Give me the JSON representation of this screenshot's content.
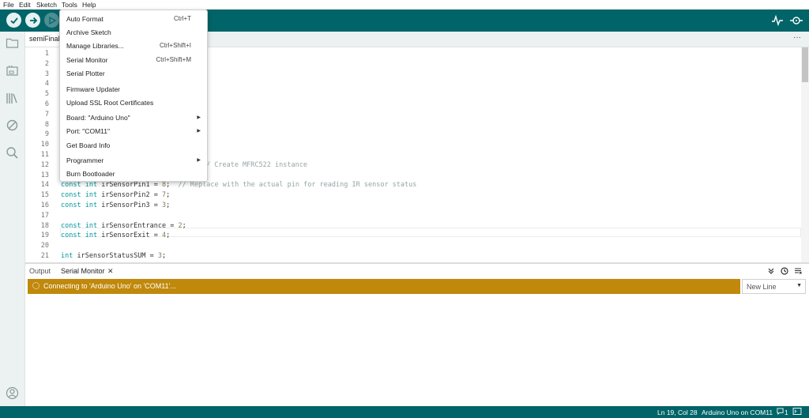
{
  "menubar": {
    "file": "File",
    "edit": "Edit",
    "sketch": "Sketch",
    "tools": "Tools",
    "help": "Help"
  },
  "toolbar": {
    "verify_icon": "check-icon",
    "upload_icon": "arrow-right-icon",
    "debug_icon": "debug-icon",
    "serial_plotter_icon": "plotter-icon",
    "serial_monitor_icon": "serial-monitor-icon",
    "accent_color": "#006468"
  },
  "tabs": {
    "active": "semiFinal",
    "more": "···"
  },
  "editor": {
    "lines": [
      {
        "n": "1",
        "text": ""
      },
      {
        "n": "2",
        "text": ""
      },
      {
        "n": "3",
        "text": ""
      },
      {
        "n": "4",
        "text": ""
      },
      {
        "n": "5",
        "text": ""
      },
      {
        "n": "6",
        "text": ""
      },
      {
        "n": "7",
        "text": ""
      },
      {
        "n": "8",
        "text": ""
      },
      {
        "n": "9",
        "text": ""
      },
      {
        "n": "10",
        "text": ""
      },
      {
        "n": "11",
        "text": ""
      },
      {
        "n": "12",
        "text": "/ Create MFRC522 instance"
      },
      {
        "n": "13",
        "text": ""
      },
      {
        "n": "14",
        "text": "const int irSensorPin1 = 8;  // Replace with the actual pin for reading IR sensor status"
      },
      {
        "n": "15",
        "text": "const int irSensorPin2 = 7;"
      },
      {
        "n": "16",
        "text": "const int irSensorPin3 = 3;"
      },
      {
        "n": "17",
        "text": ""
      },
      {
        "n": "18",
        "text": "const int irSensorEntrance = 2;"
      },
      {
        "n": "19",
        "text": "const int irSensorExit = 4;"
      },
      {
        "n": "20",
        "text": ""
      },
      {
        "n": "21",
        "text": "int irSensorStatusSUM = 3;"
      }
    ]
  },
  "tools_menu": {
    "items": [
      {
        "label": "Auto Format",
        "shortcut": "Ctrl+T"
      },
      {
        "label": "Archive Sketch",
        "shortcut": ""
      },
      {
        "label": "Manage Libraries...",
        "shortcut": "Ctrl+Shift+I"
      },
      {
        "label": "Serial Monitor",
        "shortcut": "Ctrl+Shift+M"
      },
      {
        "label": "Serial Plotter",
        "shortcut": ""
      },
      {
        "label": "Firmware Updater",
        "shortcut": ""
      },
      {
        "label": "Upload SSL Root Certificates",
        "shortcut": ""
      },
      {
        "label": "Board: \"Arduino Uno\"",
        "shortcut": ""
      },
      {
        "label": "Port: \"COM11\"",
        "shortcut": ""
      },
      {
        "label": "Get Board Info",
        "shortcut": ""
      },
      {
        "label": "Programmer",
        "shortcut": ""
      },
      {
        "label": "Burn Bootloader",
        "shortcut": ""
      }
    ]
  },
  "panel": {
    "output_tab": "Output",
    "serial_tab": "Serial Monitor",
    "close_glyph": "✕",
    "status_message": "Connecting to 'Arduino Uno' on 'COM11'...",
    "status_color": "#c0890c",
    "line_ending": "New Line"
  },
  "footer": {
    "cursor": "Ln 19, Col 28",
    "board": "Arduino Uno on COM11",
    "notifications": "1"
  }
}
